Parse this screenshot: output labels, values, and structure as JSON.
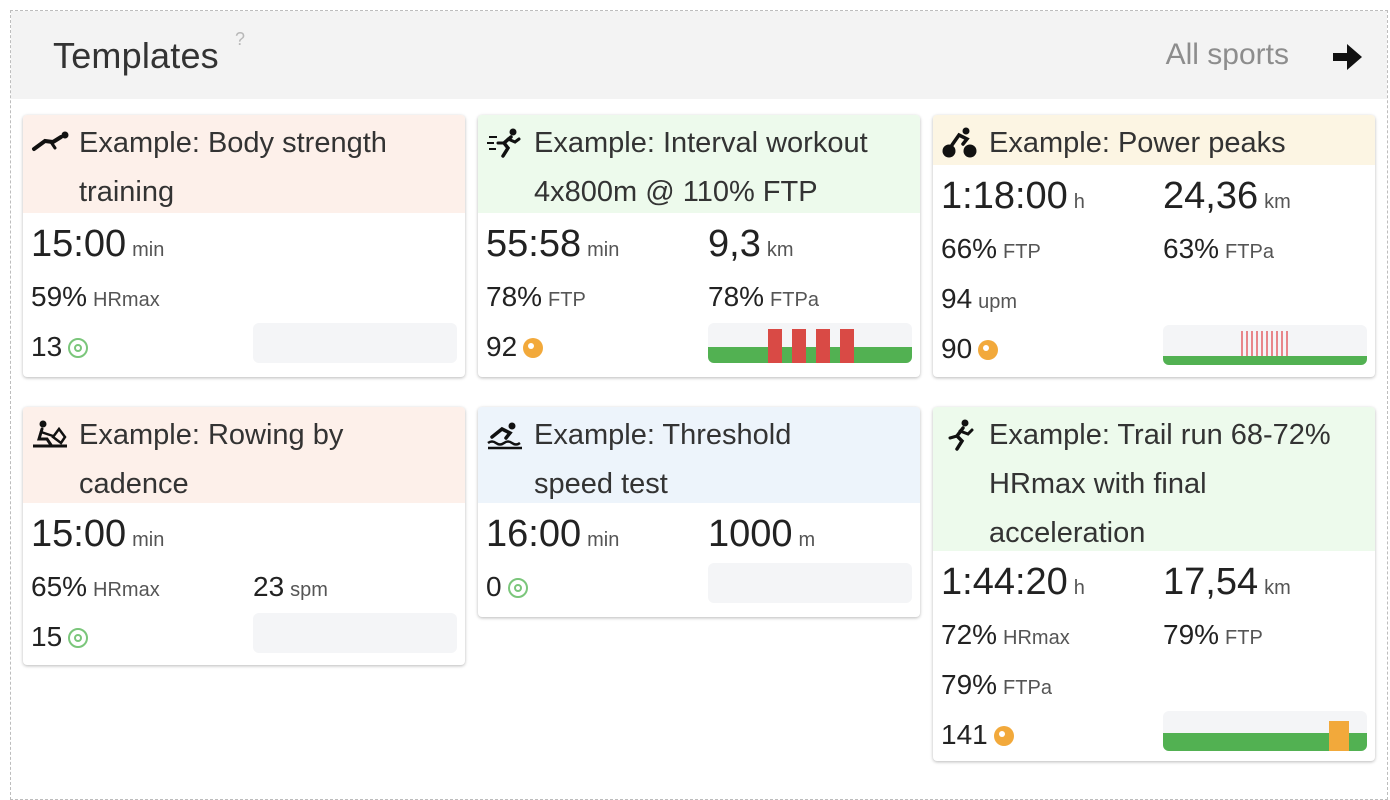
{
  "header": {
    "title": "Templates",
    "help": "?",
    "filter": "All sports"
  },
  "colors": {
    "zone_green": "#52b152",
    "zone_red": "#d94a45",
    "zone_orange": "#f2a93b",
    "tss_green": "#7bc67b"
  },
  "cards": [
    {
      "icon": "strength-icon",
      "title_line1": "Example: Body strength",
      "title_line2": "training",
      "duration": "15:00",
      "duration_unit": "min",
      "m1": "59%",
      "m1_unit": "HRmax",
      "points": "13",
      "points_icon": "target-green-icon"
    },
    {
      "icon": "running-icon",
      "title_line1": "Example: Interval workout",
      "title_line2": "4x800m @ 110% FTP",
      "duration": "55:58",
      "duration_unit": "min",
      "distance": "9,3",
      "distance_unit": "km",
      "m1": "78%",
      "m1_unit": "FTP",
      "m2": "78%",
      "m2_unit": "FTPa",
      "points": "92",
      "points_icon": "target-orange-icon"
    },
    {
      "icon": "cycling-icon",
      "title_line1": "Example: Power peaks",
      "duration": "1:18:00",
      "duration_unit": "h",
      "distance": "24,36",
      "distance_unit": "km",
      "m1": "66%",
      "m1_unit": "FTP",
      "m2": "63%",
      "m2_unit": "FTPa",
      "m3": "94",
      "m3_unit": "upm",
      "points": "90",
      "points_icon": "target-orange-icon"
    },
    {
      "icon": "rowing-icon",
      "title_line1": "Example: Rowing by",
      "title_line2": "cadence",
      "duration": "15:00",
      "duration_unit": "min",
      "m1": "65%",
      "m1_unit": "HRmax",
      "m2": "23",
      "m2_unit": "spm",
      "points": "15",
      "points_icon": "target-green-icon"
    },
    {
      "icon": "swimming-icon",
      "title_line1": "Example: Threshold",
      "title_line2": "speed test",
      "duration": "16:00",
      "duration_unit": "min",
      "distance": "1000",
      "distance_unit": "m",
      "points": "0",
      "points_icon": "target-green-icon"
    },
    {
      "icon": "trail-running-icon",
      "title_line1": "Example: Trail run 68-72%",
      "title_line2": "HRmax with final",
      "title_line3": "acceleration",
      "duration": "1:44:20",
      "duration_unit": "h",
      "distance": "17,54",
      "distance_unit": "km",
      "m1": "72%",
      "m1_unit": "HRmax",
      "m2": "79%",
      "m2_unit": "FTP",
      "m3": "79%",
      "m3_unit": "FTPa",
      "points": "141",
      "points_icon": "target-orange-icon"
    }
  ]
}
